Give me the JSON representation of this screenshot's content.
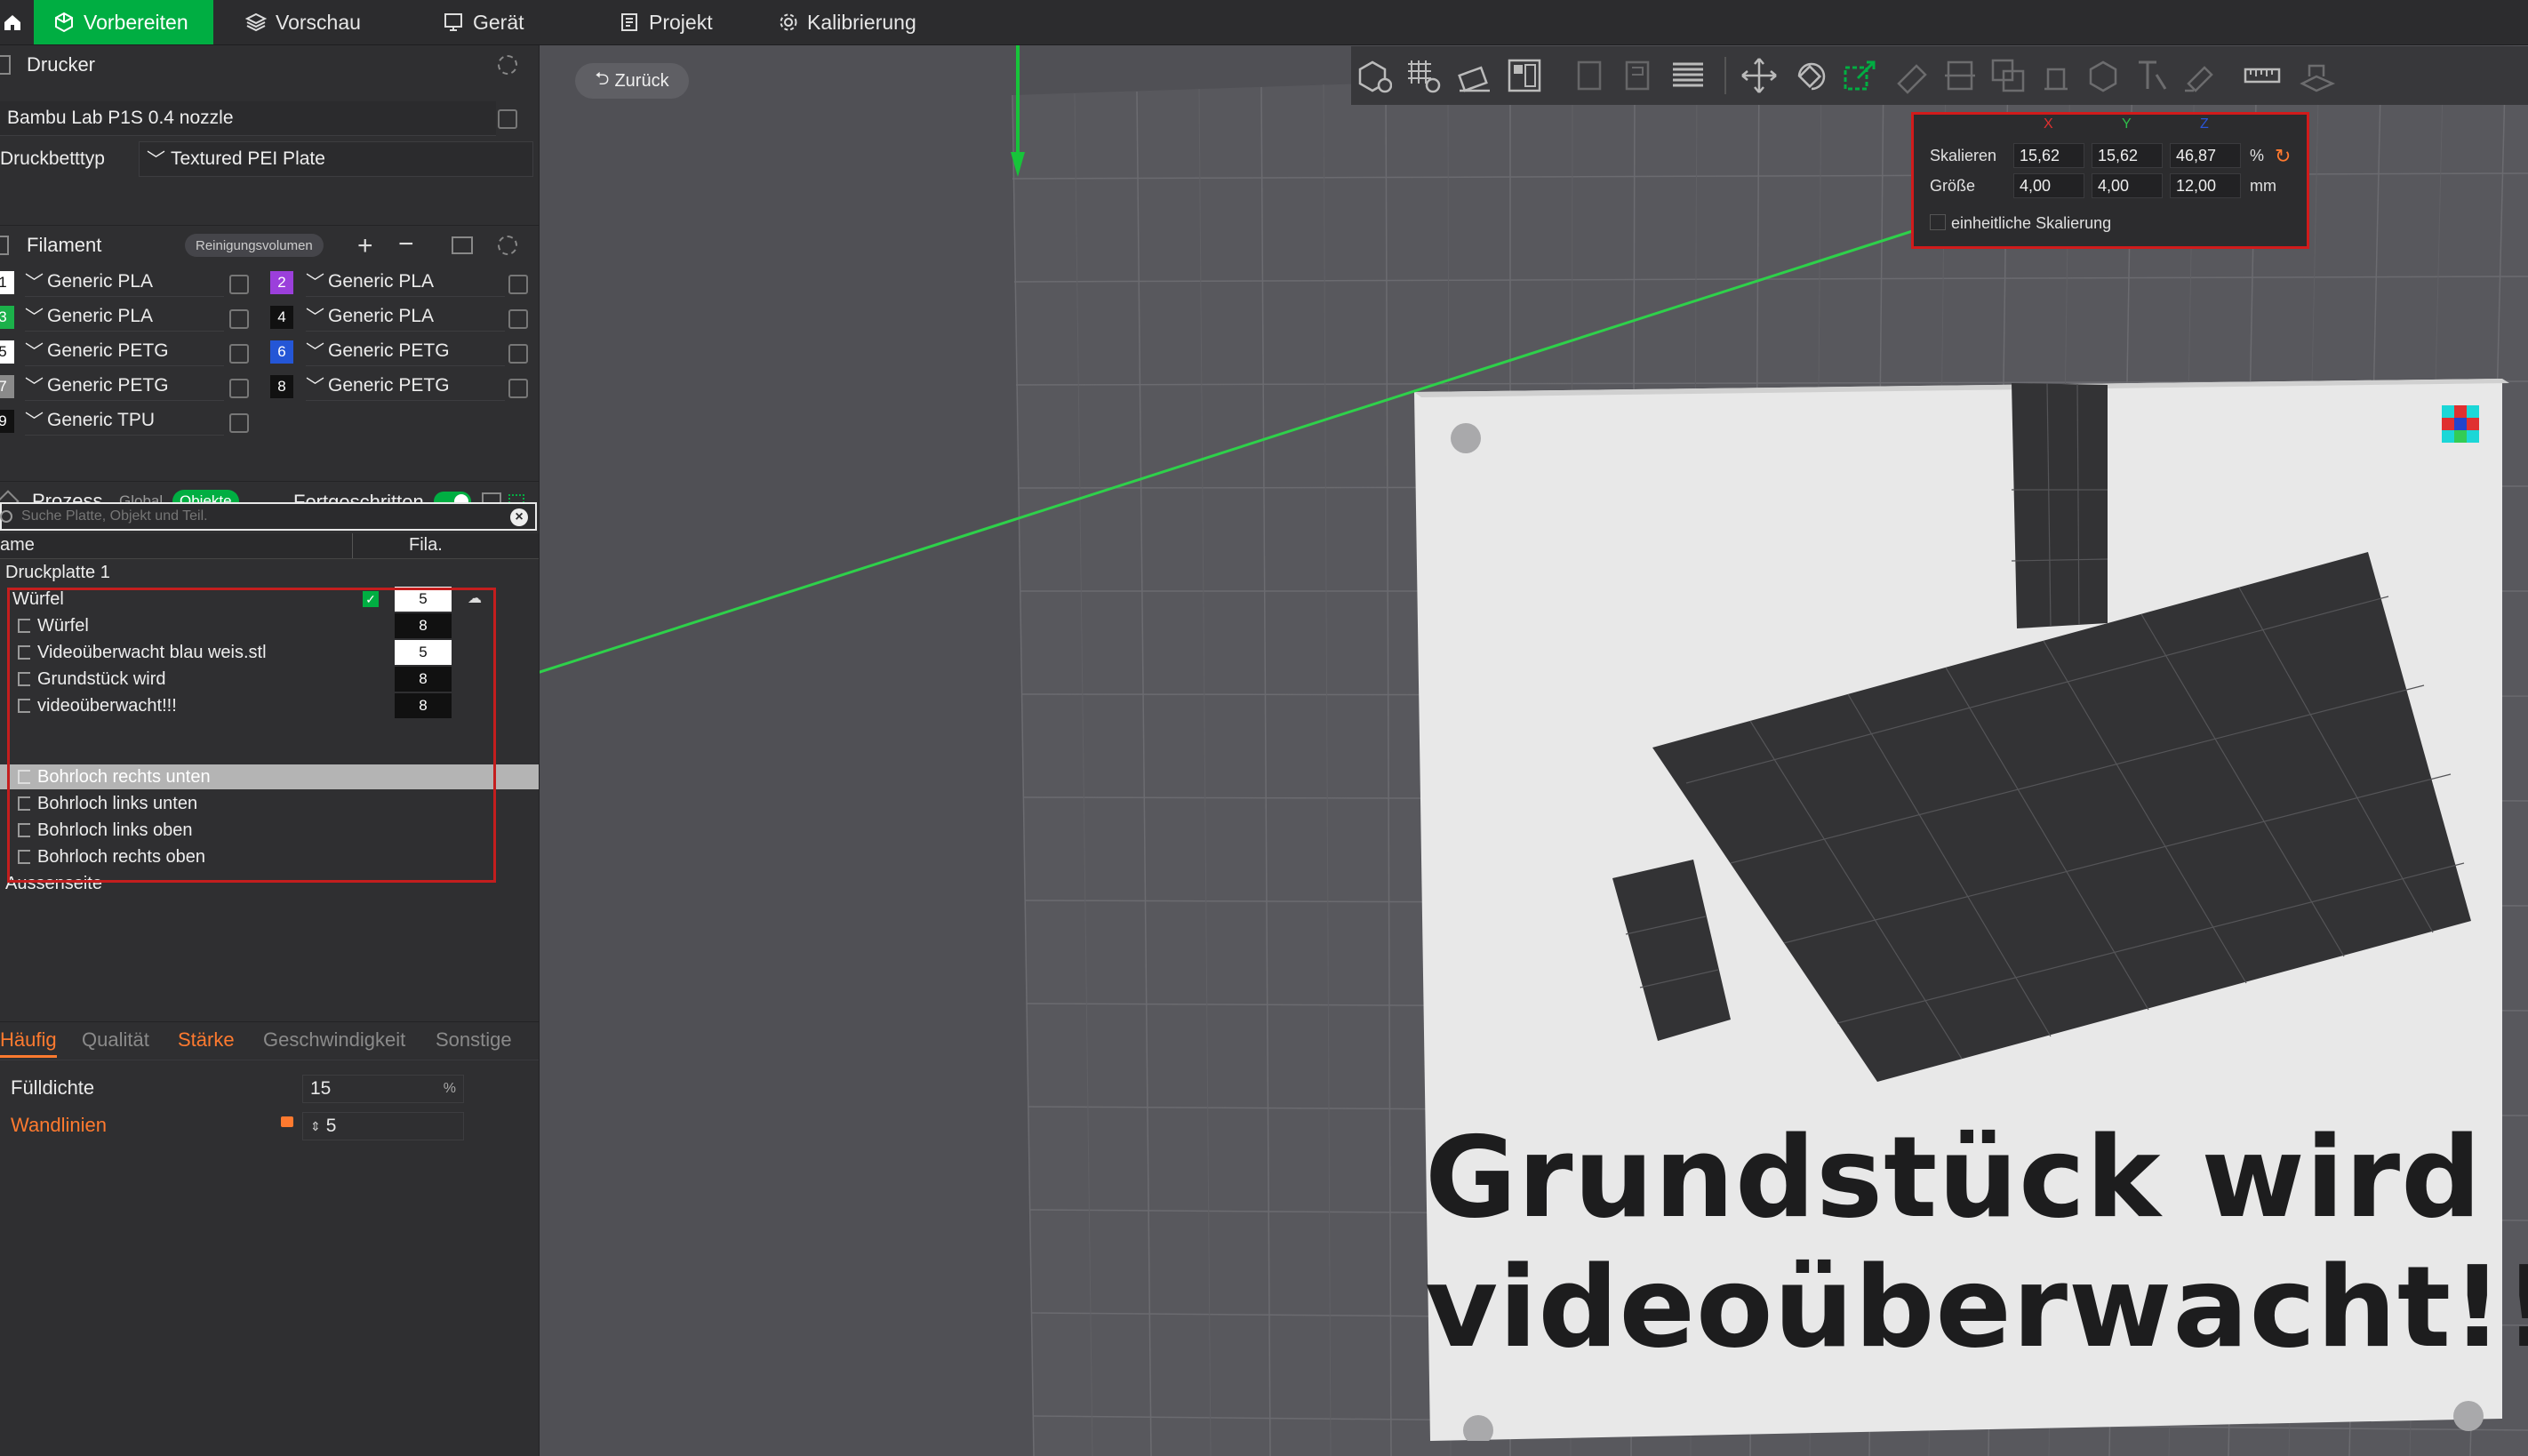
{
  "topbar": {
    "tabs": [
      {
        "label": "Vorbereiten"
      },
      {
        "label": "Vorschau"
      },
      {
        "label": "Gerät"
      },
      {
        "label": "Projekt"
      },
      {
        "label": "Kalibrierung"
      }
    ]
  },
  "printer": {
    "section_title": "Drucker",
    "printer_name": "Bambu Lab P1S 0.4 nozzle",
    "bed_label": "Druckbetttyp",
    "bed_value": "Textured PEI Plate"
  },
  "filament": {
    "section_title": "Filament",
    "flush_button": "Reinigungsvolumen",
    "slots": [
      {
        "num": "1",
        "name": "Generic PLA",
        "color": "#ffffff",
        "text": "#111111"
      },
      {
        "num": "2",
        "name": "Generic PLA",
        "color": "#9b3fdb",
        "text": "#ffffff"
      },
      {
        "num": "3",
        "name": "Generic PLA",
        "color": "#1bb14a",
        "text": "#ffffff"
      },
      {
        "num": "4",
        "name": "Generic PLA",
        "color": "#111111",
        "text": "#ffffff"
      },
      {
        "num": "5",
        "name": "Generic PETG",
        "color": "#ffffff",
        "text": "#111111"
      },
      {
        "num": "6",
        "name": "Generic PETG",
        "color": "#2456d6",
        "text": "#ffffff"
      },
      {
        "num": "7",
        "name": "Generic PETG",
        "color": "#8a8a8a",
        "text": "#ffffff"
      },
      {
        "num": "8",
        "name": "Generic PETG",
        "color": "#111111",
        "text": "#ffffff"
      },
      {
        "num": "9",
        "name": "Generic TPU",
        "color": "#111111",
        "text": "#ffffff"
      }
    ]
  },
  "process": {
    "section_title": "Prozess",
    "toggle_global": "Global",
    "toggle_objects": "Objekte",
    "advanced_label": "Fortgeschritten",
    "search_placeholder": "Suche Platte, Objekt und Teil.",
    "col_name": "ame",
    "col_fila": "Fila.",
    "plate": "Druckplatte 1",
    "objects": [
      {
        "name": "Würfel",
        "fila": "5"
      },
      {
        "name": "Würfel",
        "fila": "8"
      },
      {
        "name": "Videoüberwacht blau weis.stl",
        "fila": "5"
      },
      {
        "name": "Grundstück wird",
        "fila": "8"
      },
      {
        "name": "videoüberwacht!!!",
        "fila": "8"
      },
      {
        "name": "Bohrloch rechts unten",
        "fila": ""
      },
      {
        "name": "Bohrloch links unten",
        "fila": ""
      },
      {
        "name": "Bohrloch links oben",
        "fila": ""
      },
      {
        "name": "Bohrloch rechts oben",
        "fila": ""
      }
    ],
    "after": "Aussenseite"
  },
  "settings_tabs": [
    "Häufig",
    "Qualität",
    "Stärke",
    "Geschwindigkeit",
    "Sonstige"
  ],
  "settings": {
    "infill_label": "Fülldichte",
    "infill_value": "15",
    "infill_unit": "%",
    "walls_label": "Wandlinien",
    "walls_value": "5"
  },
  "viewport": {
    "back_button": "Zurück",
    "sign_line1": "Grundstück wird",
    "sign_line2": "videoüberwacht!!!"
  },
  "scale_panel": {
    "axes": [
      "X",
      "Y",
      "Z"
    ],
    "scale_label": "Skalieren",
    "scale": [
      "15,62",
      "15,62",
      "46,87"
    ],
    "scale_unit": "%",
    "size_label": "Größe",
    "size": [
      "4,00",
      "4,00",
      "12,00"
    ],
    "size_unit": "mm",
    "uniform_label": "einheitliche Skalierung"
  },
  "colors": {
    "accent": "#00ae42",
    "highlight_red": "#d11b1b",
    "orange": "#ff7a2f"
  }
}
